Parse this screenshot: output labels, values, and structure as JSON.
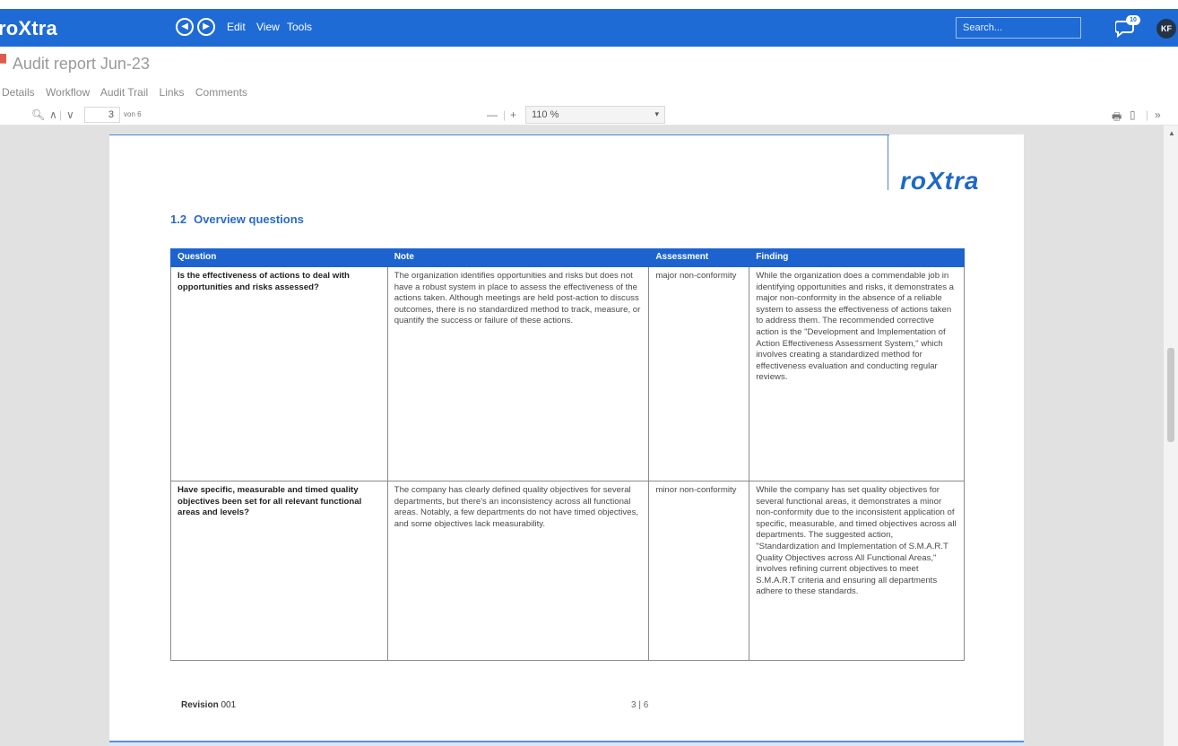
{
  "app": {
    "logo": "roXtra",
    "search_placeholder": "Search...",
    "notification_count": "10",
    "user_initials": "KF"
  },
  "menu": {
    "edit": "Edit",
    "view": "View",
    "tools": "Tools"
  },
  "document": {
    "title": "Audit report Jun-23"
  },
  "tabs": [
    "Details",
    "Workflow",
    "Audit Trail",
    "Links",
    "Comments"
  ],
  "viewer": {
    "page_value": "3",
    "page_total": "von 6",
    "zoom_minus": "—",
    "zoom_plus": "+",
    "zoom": "110 %"
  },
  "page": {
    "brand": "roXtra",
    "section_number": "1.2",
    "section_title": "Overview questions",
    "table": {
      "headers": [
        "Question",
        "Note",
        "Assessment",
        "Finding"
      ],
      "rows": [
        {
          "question": "Is the effectiveness of actions to deal with opportunities and risks assessed?",
          "note": "The organization identifies opportunities and risks but does not have a robust system in place to assess the effectiveness of the actions taken. Although meetings are held post-action to discuss outcomes, there is no standardized method to track, measure, or quantify the success or failure of these actions.",
          "assessment": "major non-conformity",
          "finding": "While the organization does a commendable job in identifying opportunities and risks, it demonstrates a major non-conformity in the absence of a reliable system to assess the effectiveness of actions taken to address them. The recommended corrective action is the \"Development and Implementation of Action Effectiveness Assessment System,\" which involves creating a standardized method for effectiveness evaluation and conducting regular reviews."
        },
        {
          "question": "Have specific, measurable and timed quality objectives been set for all relevant functional areas and levels?",
          "note": "The company has clearly defined quality objectives for several departments, but there's an inconsistency across all functional areas. Notably, a few departments do not have timed objectives, and some objectives lack measurability.",
          "assessment": "minor non-conformity",
          "finding": "While the company has set quality objectives for several functional areas, it demonstrates a minor non-conformity due to the inconsistent application of specific, measurable, and timed objectives across all departments. The suggested action, \"Standardization and Implementation of S.M.A.R.T Quality Objectives across All Functional Areas,\" involves refining current objectives to meet S.M.A.R.T criteria and ensuring all departments adhere to these standards."
        }
      ]
    },
    "footer": {
      "revision_label": "Revision",
      "revision_value": "001",
      "page_indicator": "3 | 6"
    }
  },
  "colors": {
    "accent": "#1e6bd6",
    "table_header": "#1d63d0",
    "brand": "#1f68c9"
  }
}
